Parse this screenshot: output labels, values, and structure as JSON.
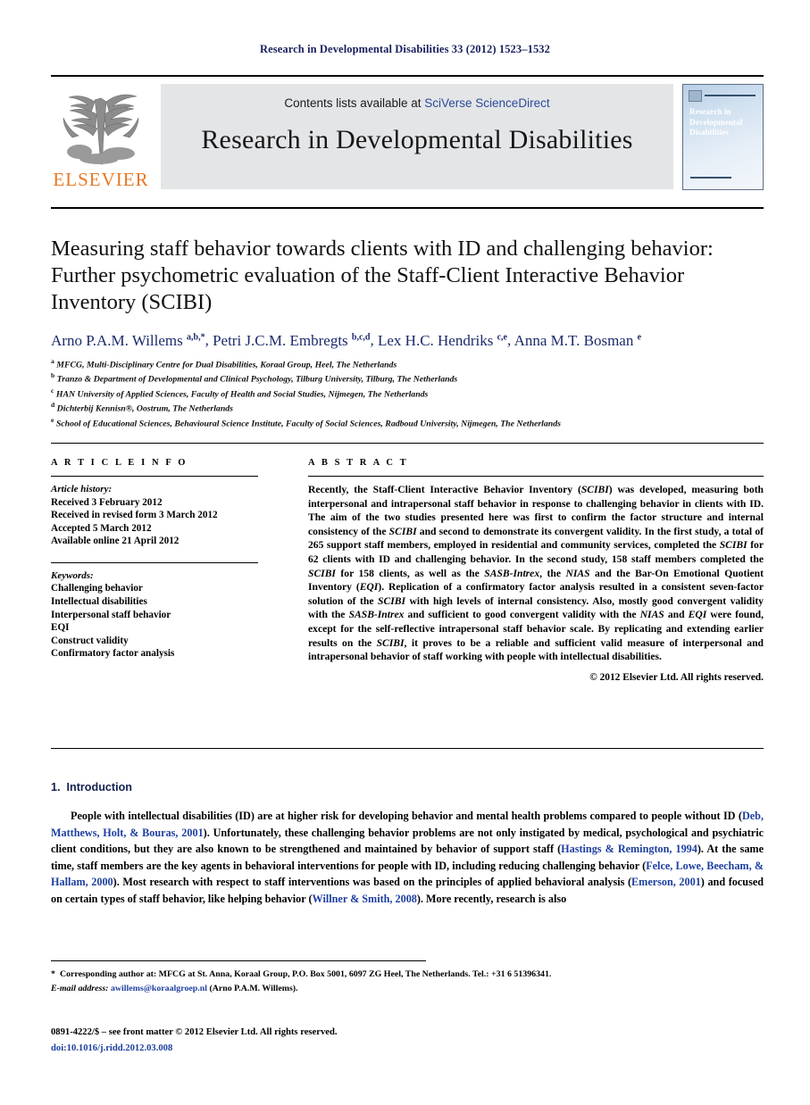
{
  "running_head": "Research in Developmental Disabilities 33 (2012) 1523–1532",
  "masthead": {
    "publisher_name": "ELSEVIER",
    "logo_alt": "elsevier-tree-logo",
    "contents_prefix": "Contents lists available at ",
    "contents_link": "SciVerse ScienceDirect",
    "journal_title": "Research in Developmental Disabilities",
    "cover_title": "Research in Developmental Disabilities"
  },
  "article": {
    "title": "Measuring staff behavior towards clients with ID and challenging behavior: Further psychometric evaluation of the Staff-Client Interactive Behavior Inventory (SCIBI)",
    "authors": [
      {
        "name": "Arno P.A.M. Willems",
        "marks": "a,b,*"
      },
      {
        "name": "Petri J.C.M. Embregts",
        "marks": "b,c,d"
      },
      {
        "name": "Lex H.C. Hendriks",
        "marks": "c,e"
      },
      {
        "name": "Anna M.T. Bosman",
        "marks": "e"
      }
    ],
    "affiliations": [
      {
        "mark": "a",
        "text": "MFCG, Multi-Disciplinary Centre for Dual Disabilities, Koraal Group, Heel, The Netherlands"
      },
      {
        "mark": "b",
        "text": "Tranzo & Department of Developmental and Clinical Psychology, Tilburg University, Tilburg, The Netherlands"
      },
      {
        "mark": "c",
        "text": "HAN University of Applied Sciences, Faculty of Health and Social Studies, Nijmegen, The Netherlands"
      },
      {
        "mark": "d",
        "text": "Dichterbij Kennisn®, Oostrum, The Netherlands"
      },
      {
        "mark": "e",
        "text": "School of Educational Sciences, Behavioural Science Institute, Faculty of Social Sciences, Radboud University, Nijmegen, The Netherlands"
      }
    ]
  },
  "article_info": {
    "heading": "A R T I C L E   I N F O",
    "history_label": "Article history:",
    "history": [
      "Received 3 February 2012",
      "Received in revised form 3 March 2012",
      "Accepted 5 March 2012",
      "Available online 21 April 2012"
    ],
    "keywords_label": "Keywords:",
    "keywords": [
      "Challenging behavior",
      "Intellectual disabilities",
      "Interpersonal staff behavior",
      "EQI",
      "Construct validity",
      "Confirmatory factor analysis"
    ]
  },
  "abstract": {
    "heading": "A B S T R A C T",
    "paragraphs": [
      "Recently, the Staff-Client Interactive Behavior Inventory (SCIBI) was developed, measuring both interpersonal and intrapersonal staff behavior in response to challenging behavior in clients with ID. The aim of the two studies presented here was first to confirm the factor structure and internal consistency of the SCIBI and second to demonstrate its convergent validity. In the first study, a total of 265 support staff members, employed in residential and community services, completed the SCIBI for 62 clients with ID and challenging behavior. In the second study, 158 staff members completed the SCIBI for 158 clients, as well as the SASB-Intrex, the NIAS and the Bar-On Emotional Quotient Inventory (EQI). Replication of a confirmatory factor analysis resulted in a consistent seven-factor solution of the SCIBI with high levels of internal consistency. Also, mostly good convergent validity with the SASB-Intrex and sufficient to good convergent validity with the NIAS and EQI were found, except for the self-reflective intrapersonal staff behavior scale. By replicating and extending earlier results on the SCIBI, it proves to be a reliable and sufficient valid measure of interpersonal and intrapersonal behavior of staff working with people with intellectual disabilities."
    ],
    "copyright": "© 2012 Elsevier Ltd. All rights reserved."
  },
  "body": {
    "section_number": "1.",
    "section_title": "Introduction",
    "paragraph": {
      "pre1": "People with intellectual disabilities (ID) are at higher risk for developing behavior and mental health problems compared to people without ID (",
      "cite1": "Deb, Matthews, Holt, & Bouras, 2001",
      "mid1": "). Unfortunately, these challenging behavior problems are not only instigated by medical, psychological and psychiatric client conditions, but they are also known to be strengthened and maintained by behavior of support staff (",
      "cite2": "Hastings & Remington, 1994",
      "mid2": "). At the same time, staff members are the key agents in behavioral interventions for people with ID, including reducing challenging behavior (",
      "cite3": "Felce, Lowe, Beecham, & Hallam, 2000",
      "mid3": "). Most research with respect to staff interventions was based on the principles of applied behavioral analysis (",
      "cite4": "Emerson, 2001",
      "mid4": ") and focused on certain types of staff behavior, like helping behavior (",
      "cite5": "Willner & Smith, 2008",
      "end": "). More recently, research is also"
    }
  },
  "footnotes": {
    "corresponding_mark": "*",
    "corresponding_text": "Corresponding author at: MFCG at St. Anna, Koraal Group, P.O. Box 5001, 6097 ZG Heel, The Netherlands. Tel.: +31 6 51396341.",
    "email_label": "E-mail address:",
    "email": "awillems@koraalgroep.nl",
    "email_suffix": "(Arno P.A.M. Willems)."
  },
  "footer": {
    "front_matter": "0891-4222/$ – see front matter © 2012 Elsevier Ltd. All rights reserved.",
    "doi": "doi:10.1016/j.ridd.2012.03.008"
  }
}
